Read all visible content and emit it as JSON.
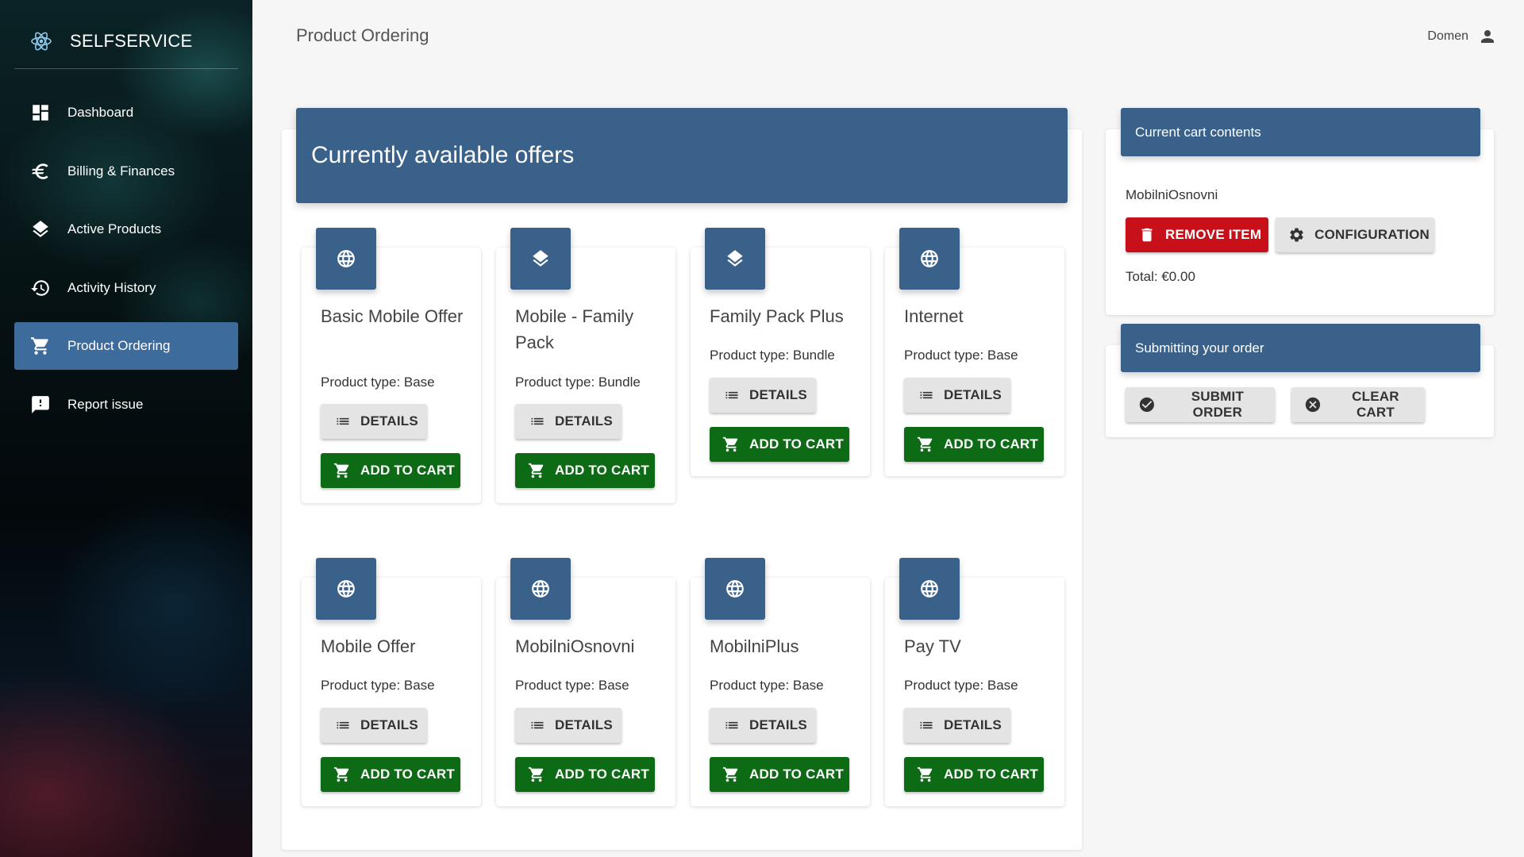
{
  "app": {
    "brand": "SELFSERVICE",
    "brand_icon": "react-atom-icon"
  },
  "sidebar": {
    "items": [
      {
        "label": "Dashboard",
        "icon": "dashboard-icon"
      },
      {
        "label": "Billing & Finances",
        "icon": "euro-icon"
      },
      {
        "label": "Active Products",
        "icon": "layers-icon"
      },
      {
        "label": "Activity History",
        "icon": "history-icon"
      },
      {
        "label": "Product Ordering",
        "icon": "cart-icon",
        "active": true
      },
      {
        "label": "Report issue",
        "icon": "report-icon"
      }
    ]
  },
  "header": {
    "title": "Product Ordering",
    "user": "Domen",
    "user_icon": "person-icon"
  },
  "offers": {
    "title": "Currently available offers",
    "details_label": "DETAILS",
    "add_label": "ADD TO CART",
    "items": [
      {
        "name": "Basic Mobile Offer",
        "type": "Product type: Base",
        "icon": "globe-icon"
      },
      {
        "name": "Mobile - Family Pack",
        "type": "Product type: Bundle",
        "icon": "layers-icon"
      },
      {
        "name": "Family Pack Plus",
        "type": "Product type: Bundle",
        "icon": "layers-icon"
      },
      {
        "name": "Internet",
        "type": "Product type: Base",
        "icon": "globe-icon"
      },
      {
        "name": "Mobile Offer",
        "type": "Product type: Base",
        "icon": "globe-icon"
      },
      {
        "name": "MobilniOsnovni",
        "type": "Product type: Base",
        "icon": "globe-icon"
      },
      {
        "name": "MobilniPlus",
        "type": "Product type: Base",
        "icon": "globe-icon"
      },
      {
        "name": "Pay TV",
        "type": "Product type: Base",
        "icon": "globe-icon"
      }
    ]
  },
  "cart": {
    "title": "Current cart contents",
    "item_name": "MobilniOsnovni",
    "remove_label": "REMOVE ITEM",
    "config_label": "CONFIGURATION",
    "total": "Total: €0.00"
  },
  "submit": {
    "title": "Submitting your order",
    "submit_label": "SUBMIT ORDER",
    "clear_label": "CLEAR CART"
  },
  "colors": {
    "primary": "#3a6189",
    "active_nav": "#3d6b9c",
    "add_green": "#0d6b16",
    "remove_red": "#c8101a"
  }
}
